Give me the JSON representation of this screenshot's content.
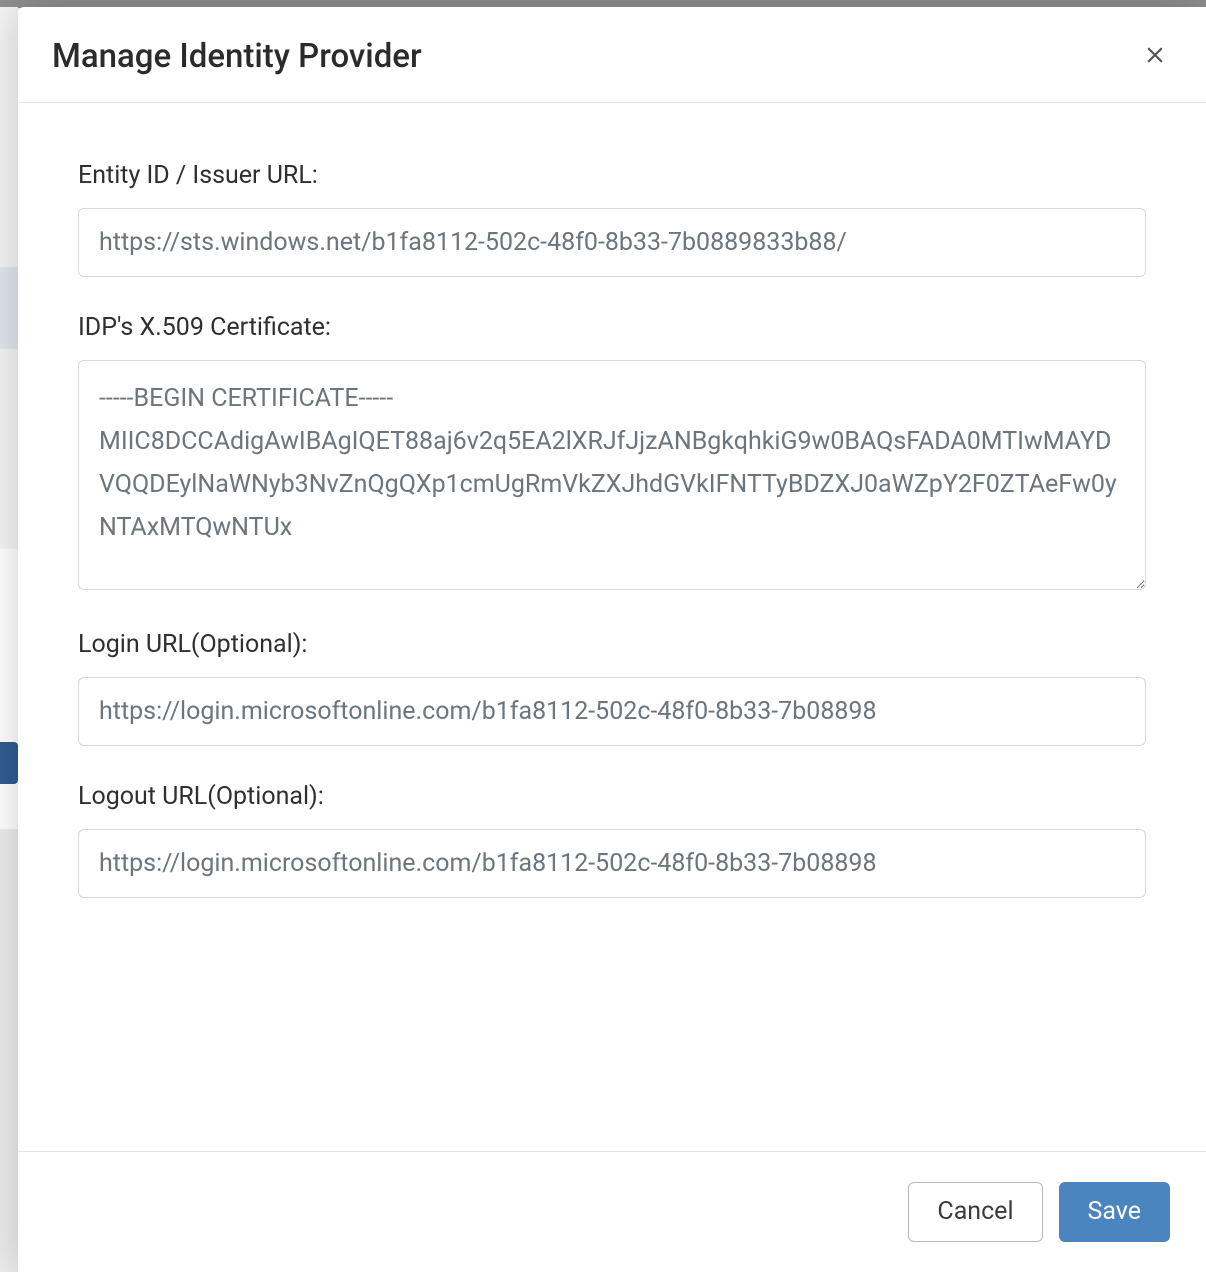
{
  "modal": {
    "title": "Manage Identity Provider",
    "fields": {
      "entity_id": {
        "label": "Entity ID / Issuer URL:",
        "value": "https://sts.windows.net/b1fa8112-502c-48f0-8b33-7b0889833b88/"
      },
      "certificate": {
        "label": "IDP's X.509 Certificate:",
        "value": "-----BEGIN CERTIFICATE-----\nMIIC8DCCAdigAwIBAgIQET88aj6v2q5EA2lXRJfJjzANBgkqhkiG9w0BAQsFADA0MTIwMAYDVQQDEylNaWNyb3NvZnQgQXp1cmUgRmVkZXJhdGVkIFNTTyBDZXJ0aWZpY2F0ZTAeFw0yNTAxMTQwNTUx"
      },
      "login_url": {
        "label": "Login URL(Optional):",
        "value": "https://login.microsoftonline.com/b1fa8112-502c-48f0-8b33-7b08898"
      },
      "logout_url": {
        "label": "Logout URL(Optional):",
        "value": "https://login.microsoftonline.com/b1fa8112-502c-48f0-8b33-7b08898"
      }
    },
    "buttons": {
      "cancel": "Cancel",
      "save": "Save"
    }
  }
}
